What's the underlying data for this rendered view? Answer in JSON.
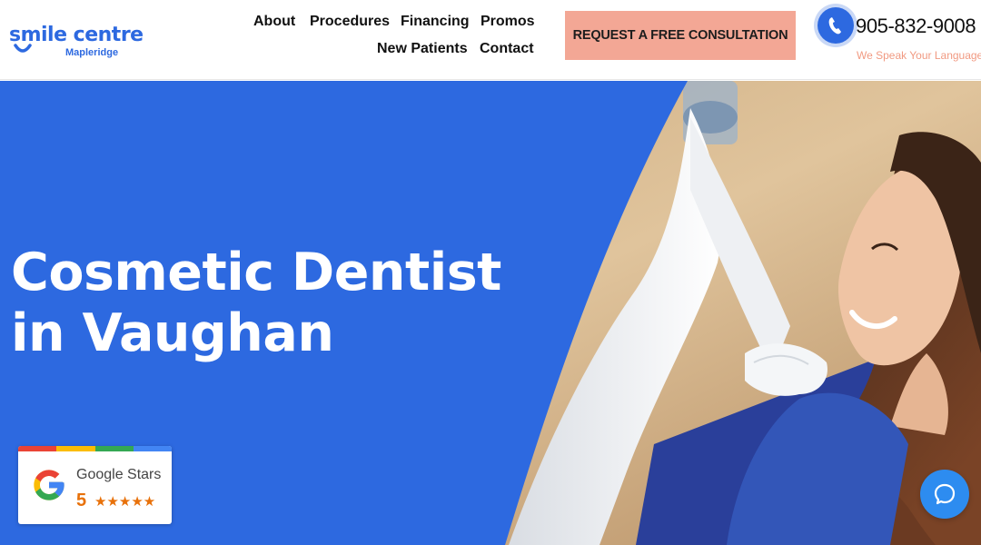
{
  "brand": {
    "name": "smile centre",
    "location": "Mapleridge",
    "color": "#2d69e0"
  },
  "nav": {
    "items": [
      {
        "label": "About"
      },
      {
        "label": "Procedures"
      },
      {
        "label": "Financing"
      },
      {
        "label": "Promos"
      },
      {
        "label": "New Patients"
      },
      {
        "label": "Contact"
      }
    ]
  },
  "cta": {
    "label": "REQUEST A FREE CONSULTATION",
    "color": "#f3a795"
  },
  "phone": {
    "icon": "phone-icon",
    "number": "905-832-9008",
    "tagline": "We Speak Your Language"
  },
  "hero": {
    "title": "Cosmetic Dentist in Vaughan",
    "panel_color": "#2d69e0"
  },
  "google_badge": {
    "icon": "google-logo-icon",
    "label": "Google Stars",
    "score": "5",
    "stars": "★★★★★",
    "star_color": "#e8710a"
  },
  "chat": {
    "icon": "chat-icon"
  }
}
